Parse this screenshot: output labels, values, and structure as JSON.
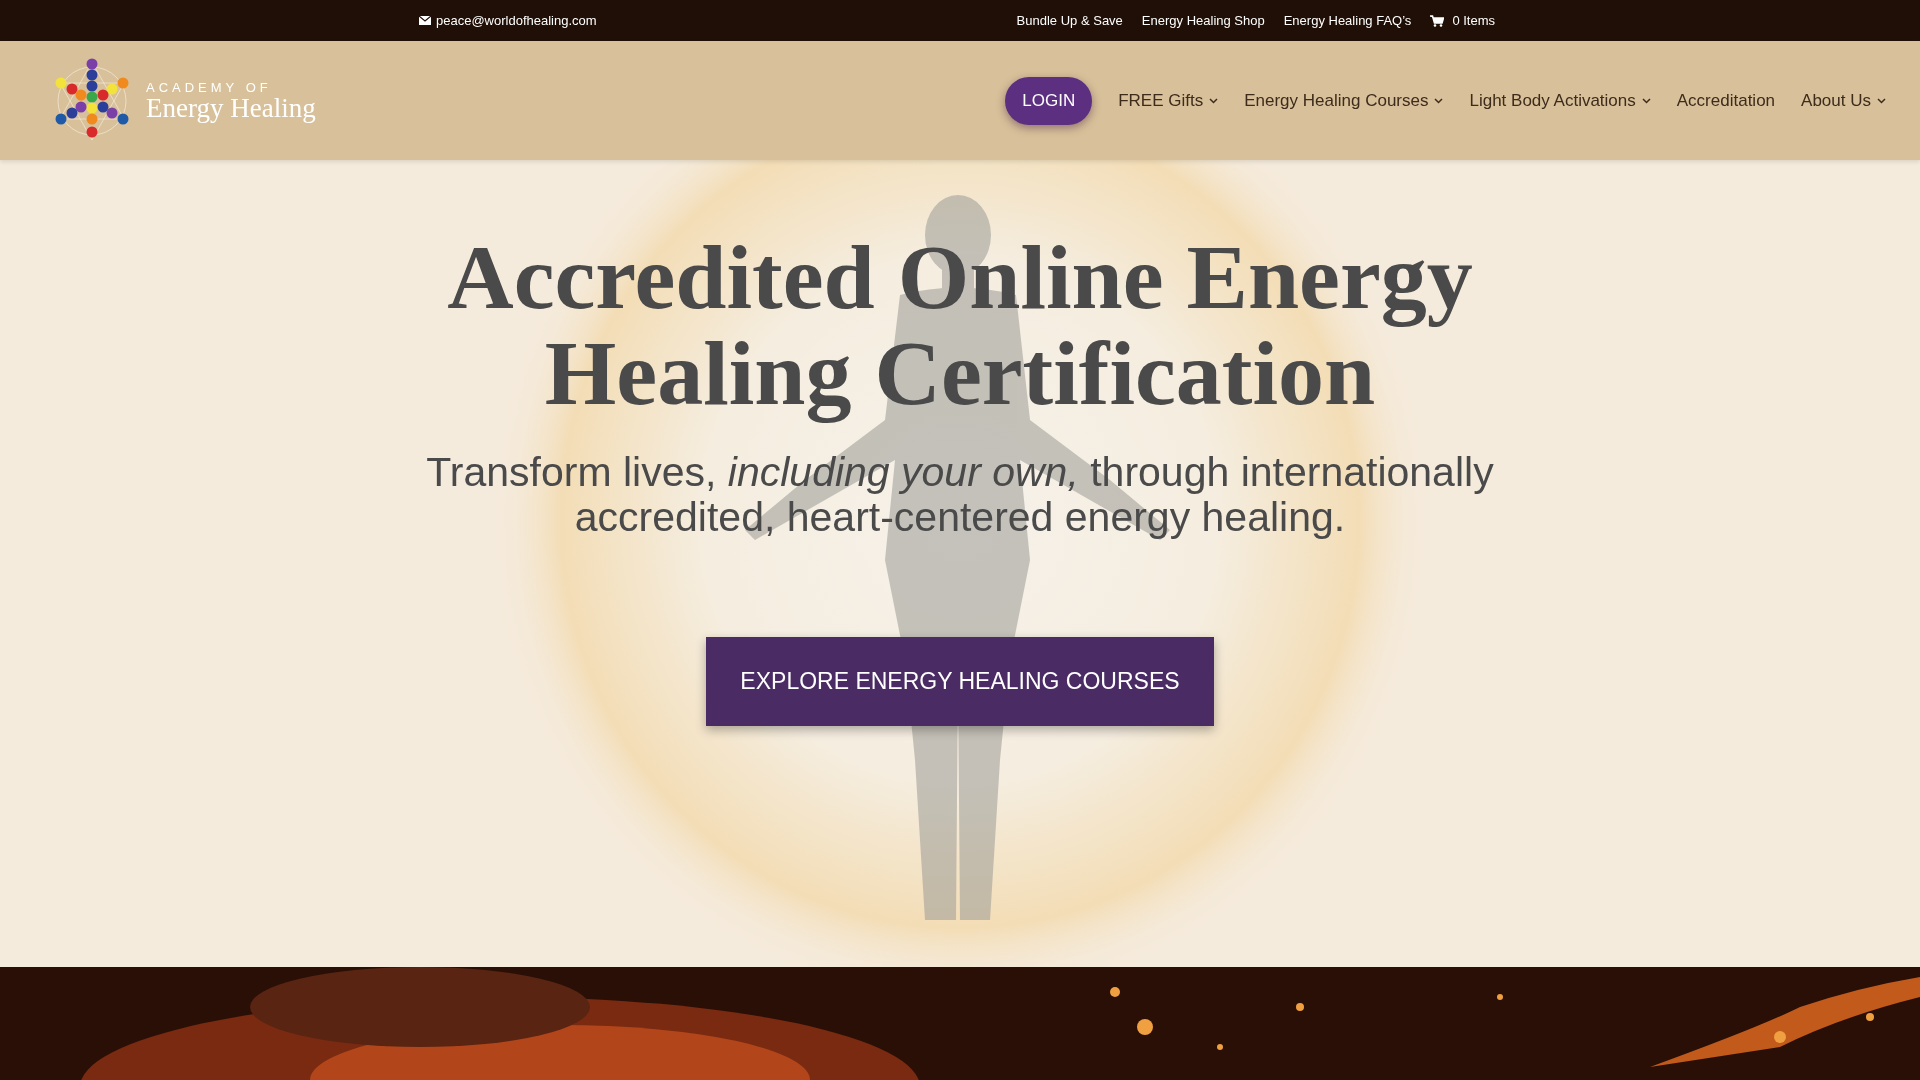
{
  "top_bar": {
    "email": "peace@worldofhealing.com",
    "links": [
      "Bundle Up & Save",
      "Energy Healing Shop",
      "Energy Healing FAQ’s"
    ],
    "cart": "0 Items"
  },
  "header": {
    "logo": {
      "small_line": "ACADEMY OF",
      "large_line": "Energy Healing"
    },
    "login": "LOGIN",
    "nav_items": [
      {
        "label": "FREE Gifts",
        "has_menu": true
      },
      {
        "label": "Energy Healing Courses",
        "has_menu": true
      },
      {
        "label": "Light Body Activations",
        "has_menu": true
      },
      {
        "label": "Accreditation",
        "has_menu": false
      },
      {
        "label": "About Us",
        "has_menu": true
      }
    ]
  },
  "hero": {
    "title": [
      "Accredited Online Energy",
      "Healing Certification"
    ],
    "subtitle": "Transform lives, *including your own,* through internationally accredited, heart-centered energy healing.",
    "button": "EXPLORE ENERGY HEALING COURSES",
    "background": {
      "kind": "picture"
    }
  },
  "next_section": {
    "background": {
      "kind": "picture"
    }
  }
}
